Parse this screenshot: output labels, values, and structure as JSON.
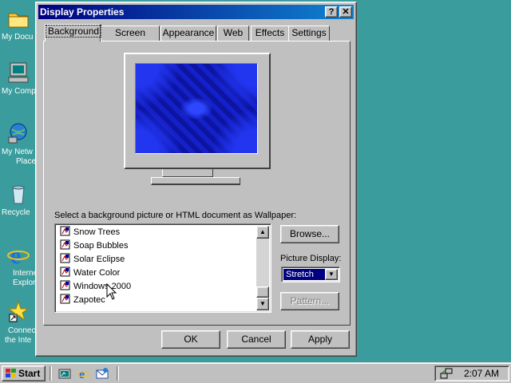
{
  "desktop": {
    "icons": [
      {
        "name": "my-documents",
        "line1": "My Docu",
        "line2": ""
      },
      {
        "name": "my-computer",
        "line1": "My Comp",
        "line2": ""
      },
      {
        "name": "my-network-places",
        "line1": "My Netw",
        "line2": "Place"
      },
      {
        "name": "recycle-bin",
        "line1": "Recycle",
        "line2": ""
      },
      {
        "name": "internet-explorer",
        "line1": "Interne",
        "line2": "Explor"
      },
      {
        "name": "connect-to-internet",
        "line1": "Connec",
        "line2": "the Inte"
      }
    ]
  },
  "window": {
    "title": "Display Properties",
    "help_label": "?",
    "close_label": "✕",
    "tabs": [
      {
        "label": "Background"
      },
      {
        "label": "Screen Saver"
      },
      {
        "label": "Appearance"
      },
      {
        "label": "Web"
      },
      {
        "label": "Effects"
      },
      {
        "label": "Settings"
      }
    ],
    "active_tab": "Background"
  },
  "background_tab": {
    "caption": "Select a background picture or HTML document as Wallpaper:",
    "wallpapers": [
      {
        "label": "Snow Trees"
      },
      {
        "label": "Soap Bubbles"
      },
      {
        "label": "Solar Eclipse"
      },
      {
        "label": "Water Color"
      },
      {
        "label": "Windows 2000"
      },
      {
        "label": "Zapotec"
      }
    ],
    "browse_label": "Browse...",
    "picture_display_label": "Picture Display:",
    "picture_display_value": "Stretch",
    "pattern_label": "Pattern..."
  },
  "footer": {
    "ok_label": "OK",
    "cancel_label": "Cancel",
    "apply_label": "Apply"
  },
  "taskbar": {
    "start_label": "Start",
    "clock": "2:07 AM"
  },
  "colors": {
    "desktop": "#3a9c9c",
    "title_start": "#000080",
    "title_end": "#1084d0",
    "face": "#c0c0c0"
  }
}
